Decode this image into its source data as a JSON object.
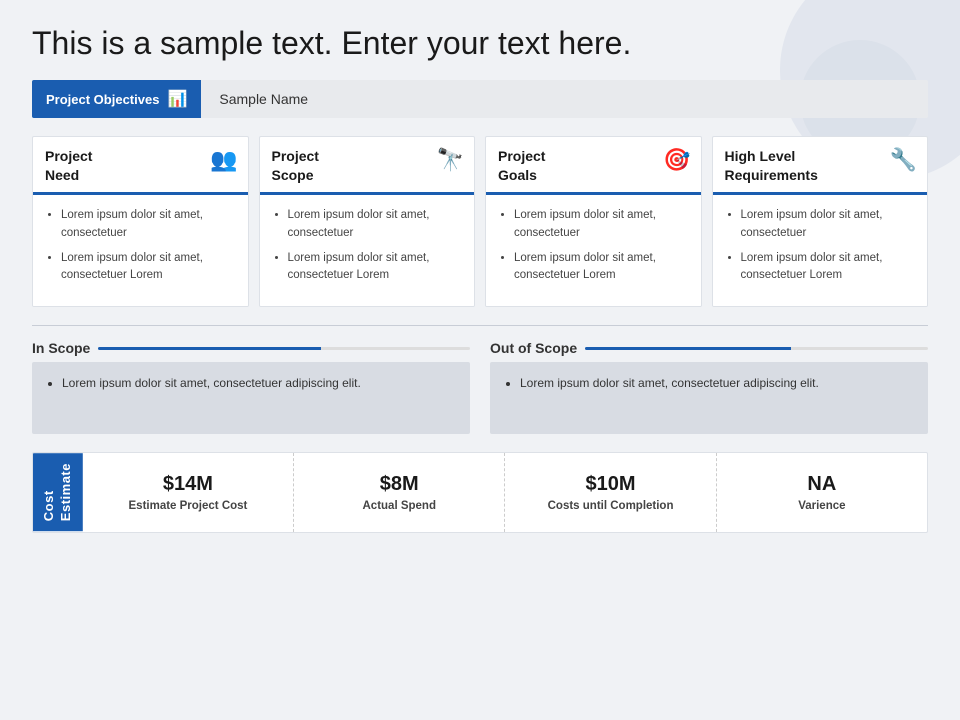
{
  "title": "This is a sample text. Enter your text here.",
  "objectives": {
    "label": "Project Objectives",
    "name": "Sample Name"
  },
  "cards": [
    {
      "id": "project-need",
      "title": "Project\nNeed",
      "icon": "👥",
      "icon_name": "people-icon",
      "bullets": [
        "Lorem ipsum dolor sit amet, consectetuer",
        "Lorem ipsum dolor sit amet, consectetuer Lorem"
      ]
    },
    {
      "id": "project-scope",
      "title": "Project\nScope",
      "icon": "🔭",
      "icon_name": "telescope-icon",
      "bullets": [
        "Lorem ipsum dolor sit amet, consectetuer",
        "Lorem ipsum dolor sit amet, consectetuer Lorem"
      ]
    },
    {
      "id": "project-goals",
      "title": "Project\nGoals",
      "icon": "🎯",
      "icon_name": "target-icon",
      "bullets": [
        "Lorem ipsum dolor sit amet, consectetuer",
        "Lorem ipsum dolor sit amet, consectetuer Lorem"
      ]
    },
    {
      "id": "high-level-requirements",
      "title": "High Level\nRequirements",
      "icon": "🔧",
      "icon_name": "wrench-icon",
      "bullets": [
        "Lorem ipsum dolor sit amet, consectetuer",
        "Lorem ipsum dolor sit amet, consectetuer Lorem"
      ]
    }
  ],
  "in_scope": {
    "title": "In Scope",
    "text": "Lorem ipsum dolor sit amet, consectetuer adipiscing elit."
  },
  "out_of_scope": {
    "title": "Out of Scope",
    "text": "Lorem ipsum dolor sit amet, consectetuer adipiscing elit."
  },
  "cost_estimate": {
    "label": "Cost\nEstimate",
    "items": [
      {
        "amount": "$14M",
        "description": "Estimate Project Cost"
      },
      {
        "amount": "$8M",
        "description": "Actual Spend"
      },
      {
        "amount": "$10M",
        "description": "Costs until Completion"
      },
      {
        "amount": "NA",
        "description": "Varience"
      }
    ]
  }
}
